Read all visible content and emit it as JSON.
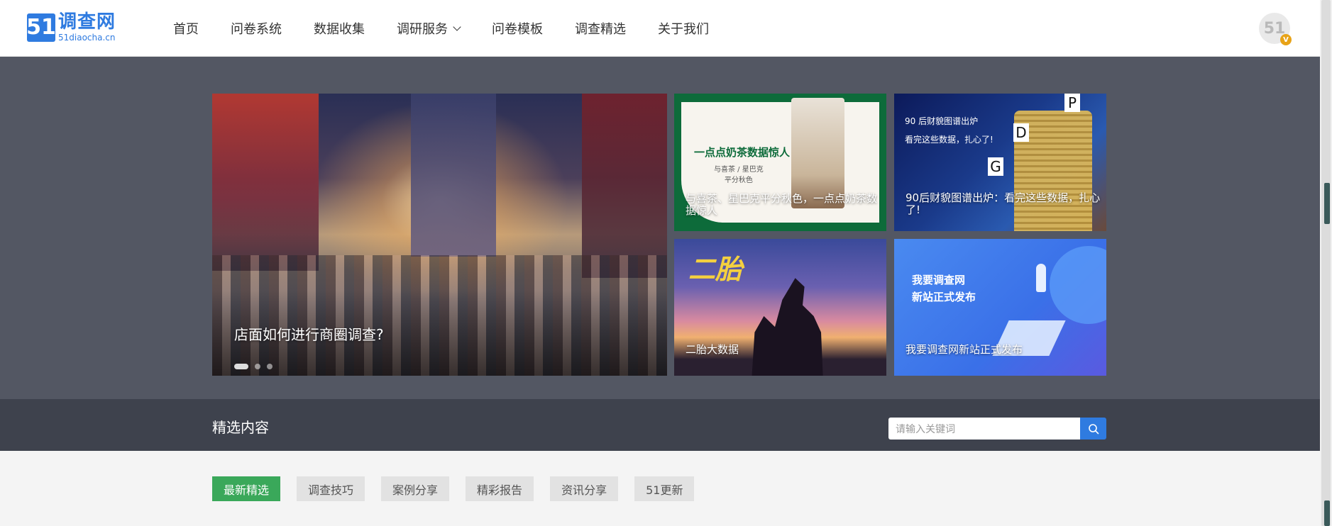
{
  "header": {
    "logo_num": "51",
    "logo_cn": "调查网",
    "logo_en": "51diaocha.cn",
    "nav": [
      "首页",
      "问卷系统",
      "数据收集",
      "调研服务",
      "问卷模板",
      "调查精选",
      "关于我们"
    ],
    "avatar_text": "51",
    "avatar_badge": "V"
  },
  "banner": {
    "main_caption": "店面如何进行商圈调查?",
    "slide_count": 3,
    "active_slide": 1,
    "tile1": {
      "ad_title": "一点点奶茶数据惊人",
      "ad_sub1": "与喜茶 / 星巴克",
      "ad_sub2": "平分秋色",
      "caption": "与喜茶、星巴克平分秋色，一点点奶茶数据惊人"
    },
    "tile2": {
      "ad_l1": "90 后财貌图谱出炉",
      "ad_l2": "看完这些数据，扎心了!",
      "letters": [
        "P",
        "D",
        "G"
      ],
      "caption": "90后财貌图谱出炉：看完这些数据，扎心了!"
    },
    "tile3": {
      "ad_text": "二胎",
      "caption": "二胎大数据"
    },
    "tile4": {
      "ad_l1": "我要调查网",
      "ad_l2": "新站正式发布",
      "caption": "我要调查网新站正式发布"
    }
  },
  "selection": {
    "title": "精选内容",
    "search_placeholder": "请输入关键词"
  },
  "tabs": [
    "最新精选",
    "调查技巧",
    "案例分享",
    "精彩报告",
    "资讯分享",
    "51更新"
  ],
  "active_tab": 0,
  "colors": {
    "brand_blue": "#2f7be0",
    "active_green": "#3aa85a",
    "banner_bg": "#535763",
    "bar_bg": "#3e424d"
  }
}
